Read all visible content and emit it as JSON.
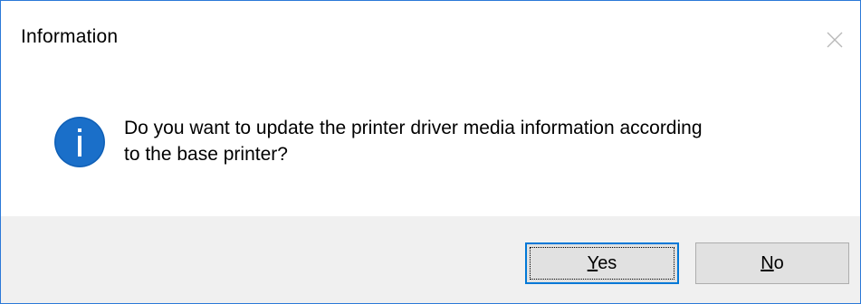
{
  "dialog": {
    "title": "Information",
    "message_line1": "Do you want to update the printer driver media information according",
    "message_line2": "to the base printer?",
    "icon": "info-icon",
    "close_icon": "close-icon"
  },
  "buttons": {
    "yes_accel": "Y",
    "yes_rest": "es",
    "no_accel": "N",
    "no_rest": "o"
  },
  "colors": {
    "border": "#2b79d8",
    "info_icon": "#1a6fc9",
    "footer_bg": "#f0f0f0",
    "default_button_border": "#0078d7"
  }
}
